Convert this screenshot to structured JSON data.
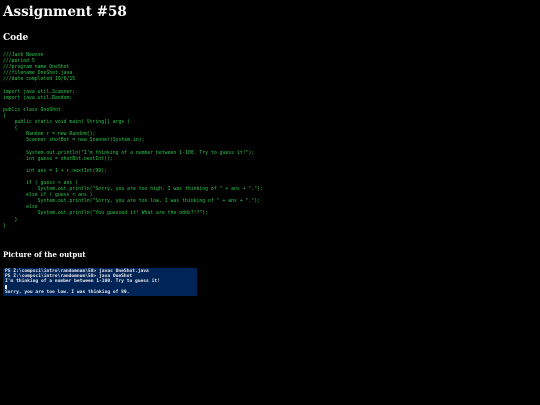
{
  "page": {
    "title": "Assignment #58",
    "code_heading": "Code",
    "output_heading": "Picture of the output"
  },
  "code": {
    "lines": [
      "///Jack Newson",
      "///period 5",
      "///program name OneShot",
      "///filename OneShot.java",
      "///date completed 10/6/15",
      "",
      "import java.util.Scanner;",
      "import java.util.Random;",
      "",
      "public class OneShot",
      "{",
      "    public static void main( String[] args )",
      "    {",
      "        Random r = new Random();",
      "        Scanner shotBot = new Scanner(System.in);",
      "",
      "        System.out.println(\"I'm thinking of a number between 1-100. Try to guess it!\");",
      "        int guess = shotBot.nextInt();",
      "",
      "        int ans = 1 + r.nextInt(99);",
      "",
      "        if ( guess > ans )",
      "            System.out.println(\"Sorry, you are too high. I was thinking of \" + ans + \".\");",
      "        else if ( guess < ans )",
      "            System.out.println(\"Sorry, you are too low. I was thinking of \" + ans + \".\");",
      "        else",
      "            System.out.println(\"You guessed it! What are the odds?!?\");",
      "    }",
      "}"
    ]
  },
  "terminal": {
    "lines": [
      "PS Z:\\compsci\\intro\\randomnum\\58> javac OneShot.java",
      "PS Z:\\compsci\\intro\\randomnum\\58> java OneShot",
      "I'm thinking of a number between 1-100. Try to guess it!",
      "",
      "Sorry, you are too low. I was thinking of 89."
    ]
  },
  "colors": {
    "background": "#000000",
    "code_text": "#2dc64d",
    "terminal_background": "#012456",
    "terminal_text": "#eeedf0"
  }
}
